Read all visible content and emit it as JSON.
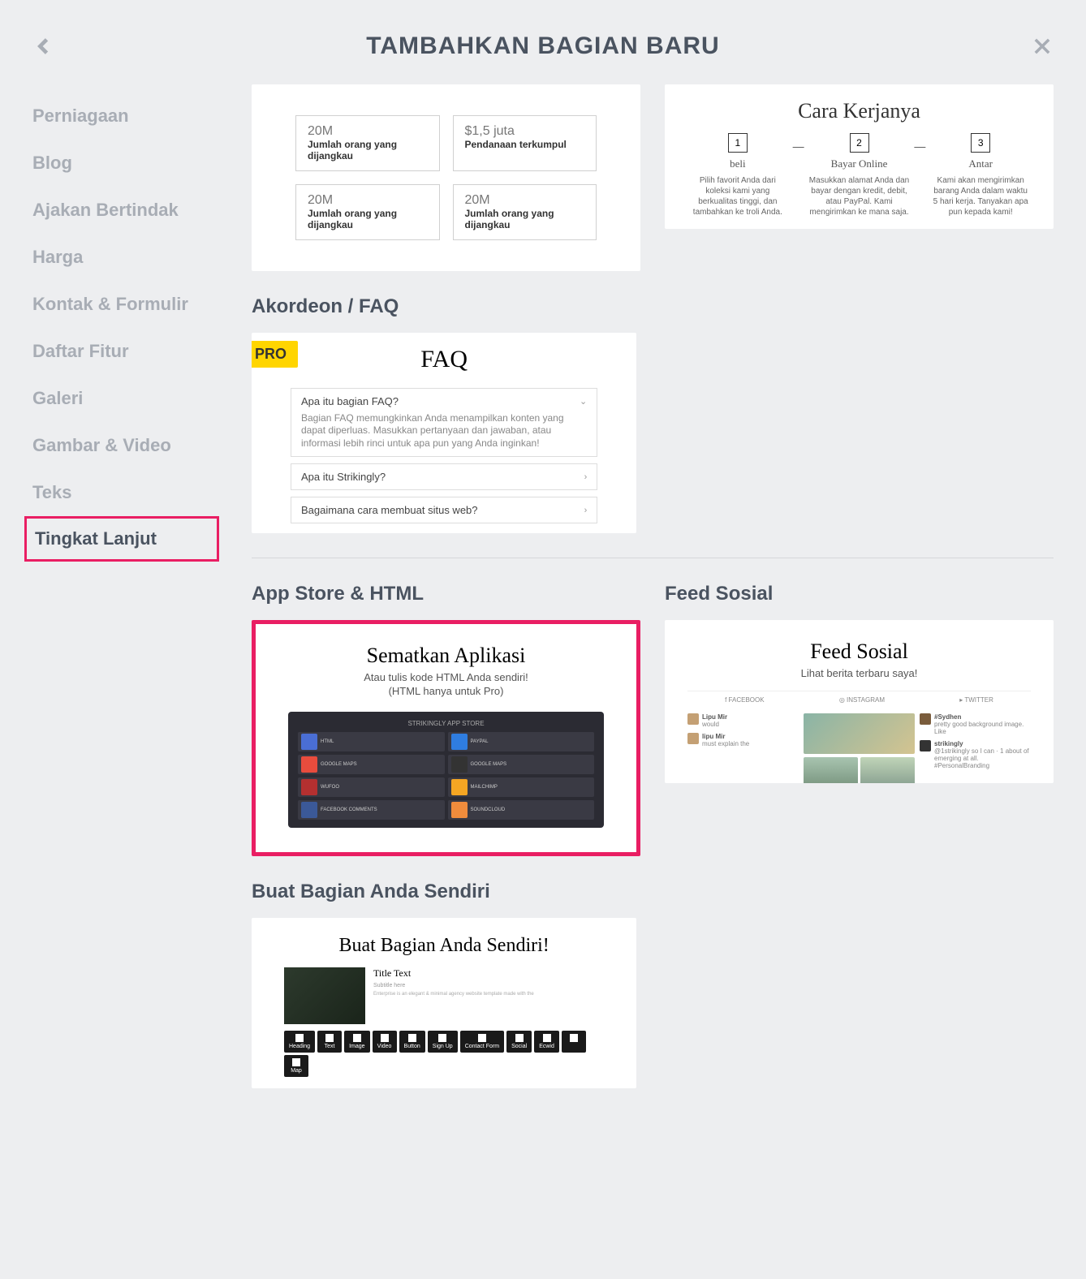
{
  "header": {
    "title": "TAMBAHKAN BAGIAN BARU"
  },
  "sidebar": {
    "items": [
      {
        "label": "Perniagaan"
      },
      {
        "label": "Blog"
      },
      {
        "label": "Ajakan Bertindak"
      },
      {
        "label": "Harga"
      },
      {
        "label": "Kontak & Formulir"
      },
      {
        "label": "Daftar Fitur"
      },
      {
        "label": "Galeri"
      },
      {
        "label": "Gambar & Video"
      },
      {
        "label": "Teks"
      },
      {
        "label": "Tingkat Lanjut"
      }
    ],
    "active_index": 9
  },
  "sections": {
    "stats": {
      "items": [
        {
          "value": "20M",
          "label": "Jumlah orang yang dijangkau"
        },
        {
          "value": "$1,5 juta",
          "label": "Pendanaan terkumpul"
        },
        {
          "value": "20M",
          "label": "Jumlah orang yang dijangkau"
        },
        {
          "value": "20M",
          "label": "Jumlah orang yang dijangkau"
        }
      ]
    },
    "howitworks": {
      "title": "Cara Kerjanya",
      "steps": [
        {
          "num": "1",
          "title": "beli",
          "desc": "Pilih favorit Anda dari koleksi kami yang berkualitas tinggi, dan tambahkan ke troli Anda."
        },
        {
          "num": "2",
          "title": "Bayar Online",
          "desc": "Masukkan alamat Anda dan bayar dengan kredit, debit, atau PayPal. Kami mengirimkan ke mana saja."
        },
        {
          "num": "3",
          "title": "Antar",
          "desc": "Kami akan mengirimkan barang Anda dalam waktu 5 hari kerja. Tanyakan apa pun kepada kami!"
        }
      ]
    },
    "faq": {
      "section_title": "Akordeon / FAQ",
      "badge": "PRO",
      "title": "FAQ",
      "items": [
        {
          "q": "Apa itu bagian FAQ?",
          "a": "Bagian FAQ memungkinkan Anda menampilkan konten yang dapat diperluas. Masukkan pertanyaan dan jawaban, atau informasi lebih rinci untuk apa pun yang Anda inginkan!",
          "open": true
        },
        {
          "q": "Apa itu Strikingly?",
          "open": false
        },
        {
          "q": "Bagaimana cara membuat situs web?",
          "open": false
        }
      ]
    },
    "appstore": {
      "section_title": "App Store & HTML",
      "title": "Sematkan Aplikasi",
      "sub": "Atau tulis kode HTML Anda sendiri!\n(HTML hanya untuk Pro)",
      "mock_title": "STRIKINGLY APP STORE",
      "tiles": [
        {
          "color": "#4a6ed4",
          "label": "HTML"
        },
        {
          "color": "#2f7de0",
          "label": "PAYPAL"
        },
        {
          "color": "#e84c3d",
          "label": "GOOGLE MAPS"
        },
        {
          "color": "#333333",
          "label": "GOOGLE MAPS"
        },
        {
          "color": "#b43030",
          "label": "WUFOO"
        },
        {
          "color": "#f5a623",
          "label": "MAILCHIMP"
        },
        {
          "color": "#3b5998",
          "label": "FACEBOOK COMMENTS"
        },
        {
          "color": "#f08c3c",
          "label": "SOUNDCLOUD"
        }
      ]
    },
    "social": {
      "section_title": "Feed Sosial",
      "title": "Feed Sosial",
      "sub": "Lihat berita terbaru saya!",
      "tabs": [
        "f  FACEBOOK",
        "◎ INSTAGRAM",
        "▸ TWITTER"
      ],
      "fb": [
        {
          "name": "Lipu Mir",
          "txt": "would"
        },
        {
          "name": "lipu Mir",
          "txt": "must explain the"
        }
      ],
      "tw": [
        {
          "name": "#Sydhen",
          "txt": "pretty good background image. Like"
        },
        {
          "name": "strikingly",
          "txt": "@1strikingly so I can · 1 about of emerging at all. #PersonalBranding"
        }
      ]
    },
    "myo": {
      "section_title": "Buat Bagian Anda Sendiri",
      "title": "Buat Bagian Anda Sendiri!",
      "mock": {
        "title": "Title Text",
        "sub": "Subtitle here",
        "desc": "Enterprise is an elegant & minimal agency website template made with the"
      },
      "toolbar": [
        "Heading",
        "Text",
        "Image",
        "Video",
        "Button",
        "Sign Up",
        "Contact Form",
        "Social",
        "Ecwid",
        "</>",
        "Map"
      ]
    }
  }
}
